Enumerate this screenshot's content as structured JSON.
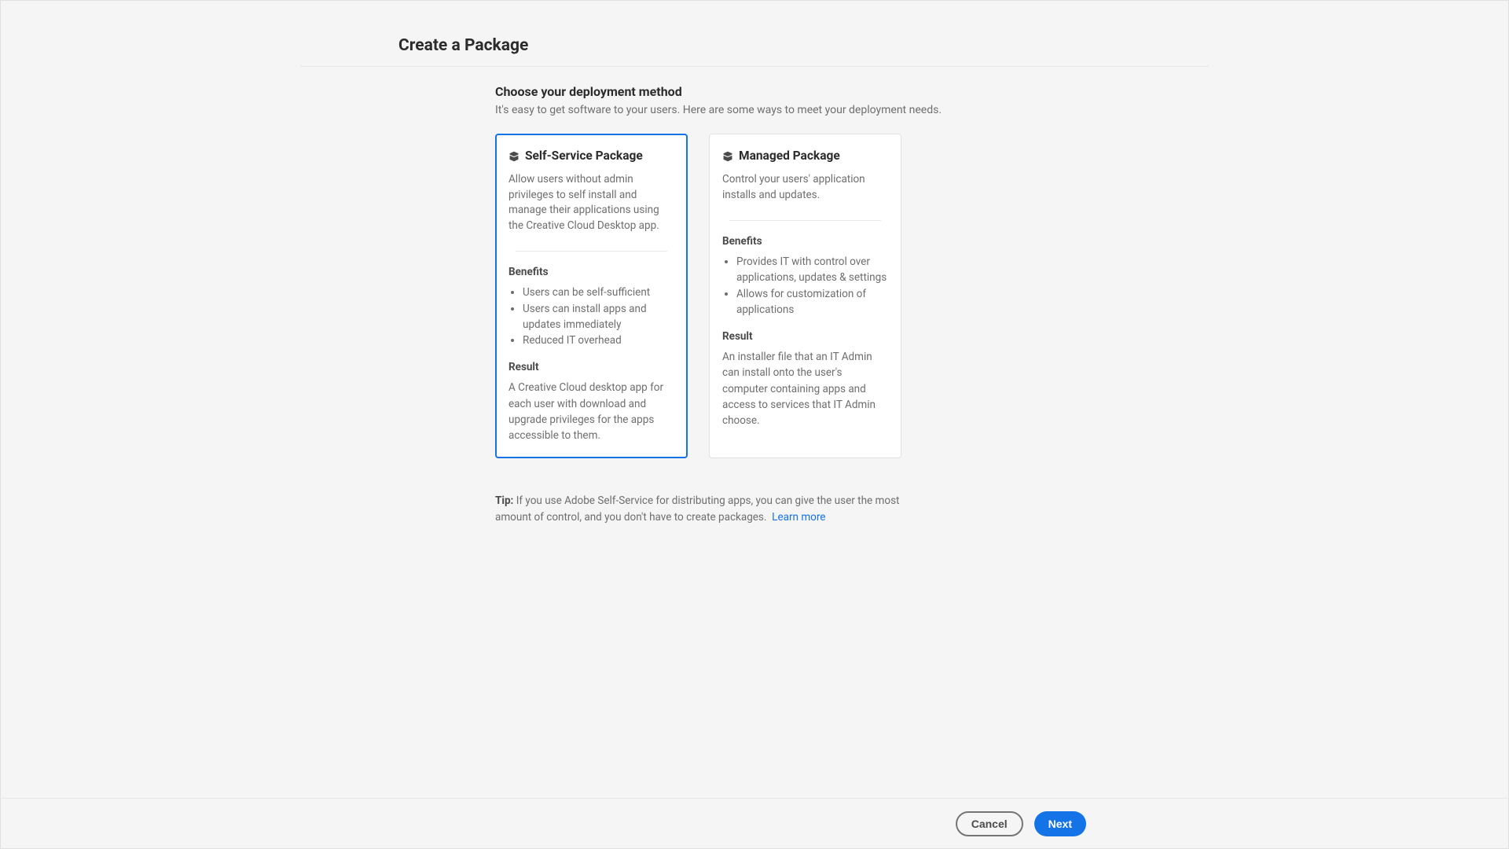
{
  "header": {
    "title": "Create a Package"
  },
  "section": {
    "title": "Choose your deployment method",
    "subtitle": "It's easy to get software to your users. Here are some ways to meet your deployment needs."
  },
  "labels": {
    "benefits": "Benefits",
    "result": "Result"
  },
  "cards": [
    {
      "title": "Self-Service Package",
      "description": "Allow users without admin privileges to self install and manage their applications using the Creative Cloud Desktop app.",
      "benefits": [
        "Users can be self-sufficient",
        "Users can install apps and updates immediately",
        "Reduced IT overhead"
      ],
      "result": "A Creative Cloud desktop app for each user with download and upgrade privileges for the apps accessible to them.",
      "selected": true
    },
    {
      "title": "Managed Package",
      "description": "Control your users' application installs and updates.",
      "benefits": [
        "Provides IT with control over applications, updates & settings",
        "Allows for customization of applications"
      ],
      "result": "An installer file that an IT Admin can install onto the user's computer containing apps and access to services that IT Admin choose.",
      "selected": false
    }
  ],
  "tip": {
    "label": "Tip: ",
    "text": "If you use Adobe Self-Service for distributing apps, you can give the user the most amount of control, and you don't have to create packages.",
    "link": "Learn more"
  },
  "footer": {
    "cancel": "Cancel",
    "next": "Next"
  }
}
